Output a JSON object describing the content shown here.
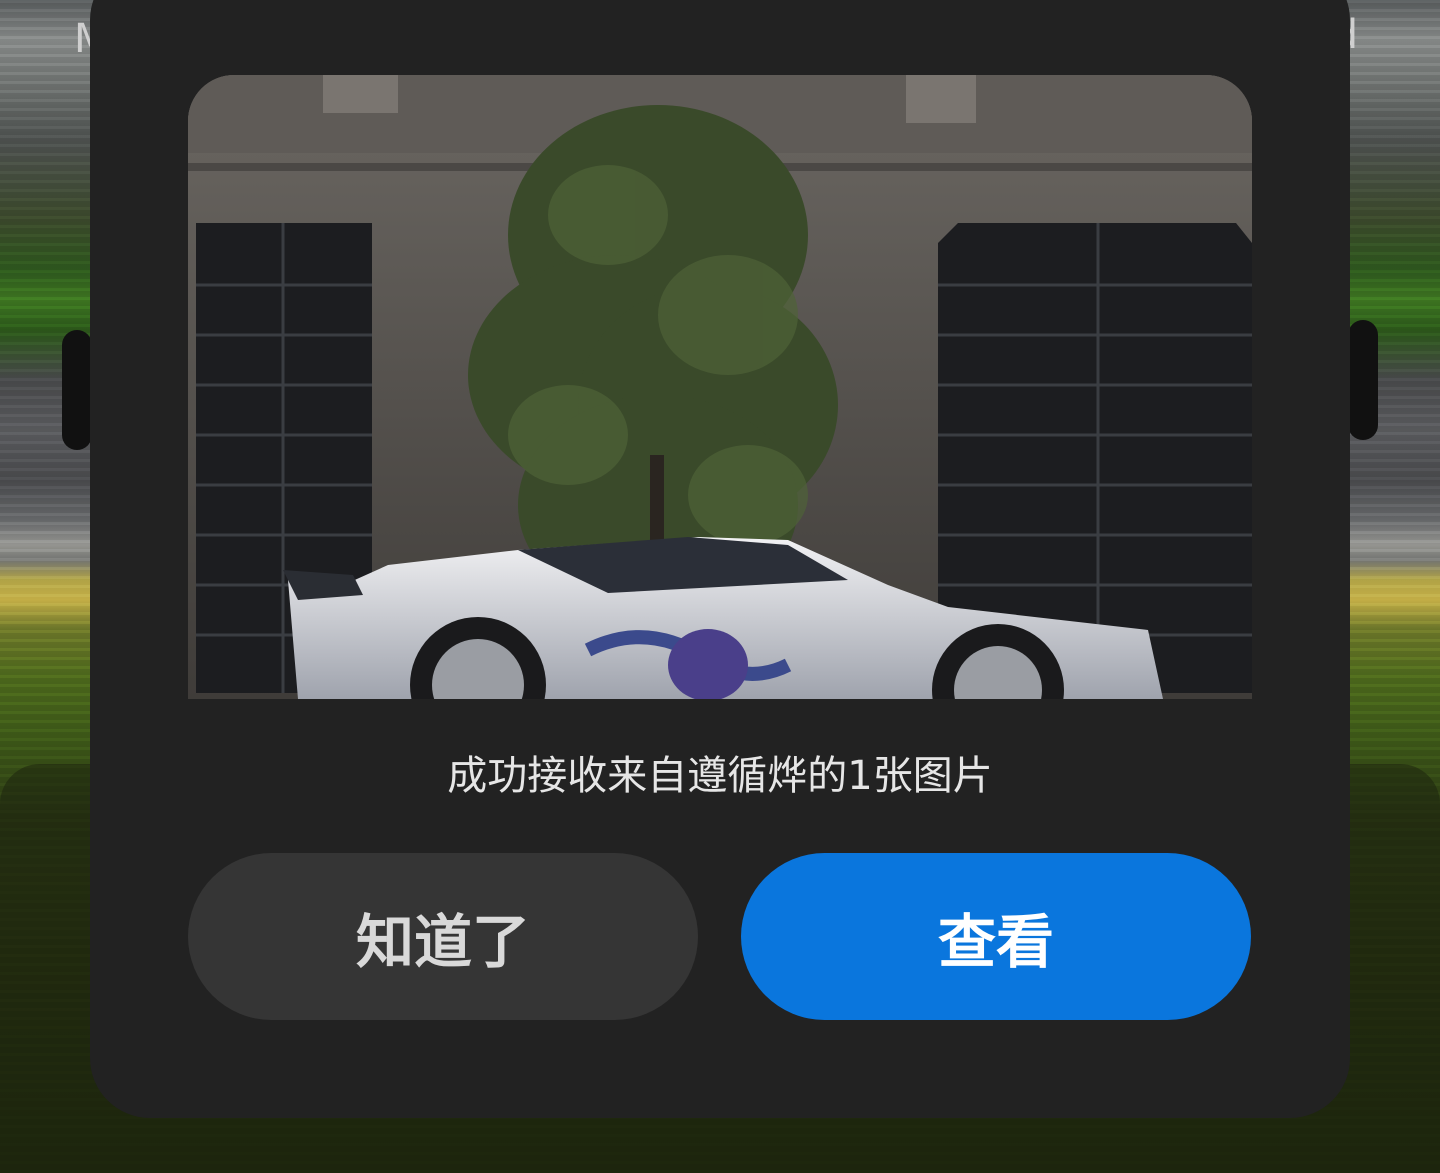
{
  "background": {
    "hud_left_text": "M",
    "hud_right_text": "d"
  },
  "dialog": {
    "preview_image": "racing-car-screenshot",
    "message": "成功接收来自遵循烨的1张图片",
    "dismiss_label": "知道了",
    "view_label": "查看",
    "colors": {
      "dialog_bg": "#222222",
      "dismiss_bg": "#353535",
      "view_bg": "#0a76dd"
    }
  }
}
